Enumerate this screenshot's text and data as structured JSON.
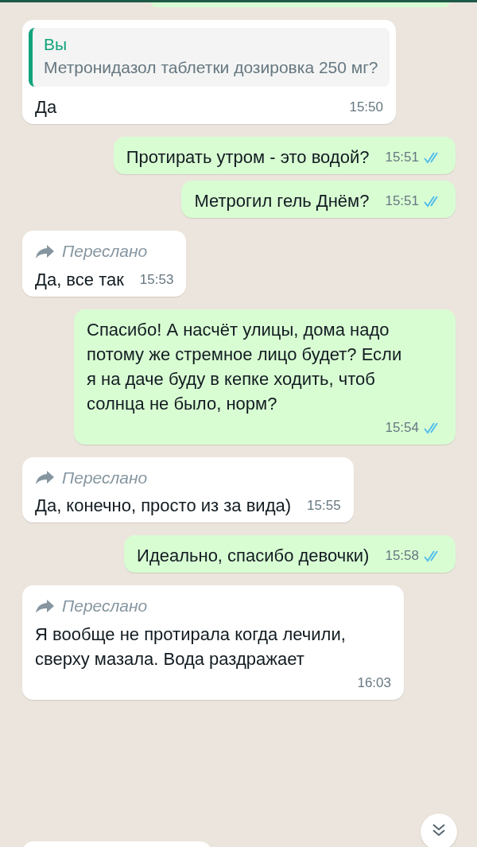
{
  "messages": [
    {
      "outgoing": false,
      "quote": {
        "author": "Вы",
        "text": "Метронидазол таблетки дозировка 250 мг?"
      },
      "text": "Да",
      "time": "15:50"
    },
    {
      "outgoing": true,
      "text": "Протирать утром - это водой?",
      "time": "15:51",
      "read": true
    },
    {
      "outgoing": true,
      "text": "Метрогил гель Днём?",
      "time": "15:51",
      "read": true
    },
    {
      "outgoing": false,
      "forwarded_label": "Переслано",
      "text": "Да, все так",
      "time": "15:53"
    },
    {
      "outgoing": true,
      "text": "Спасибо! А насчёт улицы, дома надо потому же стремное лицо будет? Если я на даче буду в кепке ходить, чтоб солнца не было, норм?",
      "time": "15:54",
      "read": true
    },
    {
      "outgoing": false,
      "forwarded_label": "Переслано",
      "text": "Да, конечно, просто из за вида)",
      "time": "15:55"
    },
    {
      "outgoing": true,
      "text": "Идеально, спасибо девочки)",
      "time": "15:58",
      "read": true
    },
    {
      "outgoing": false,
      "forwarded_label": "Переслано",
      "text": "Я вообще не протирала когда лечили, сверху мазала. Вода раздражает",
      "time": "16:03"
    }
  ]
}
